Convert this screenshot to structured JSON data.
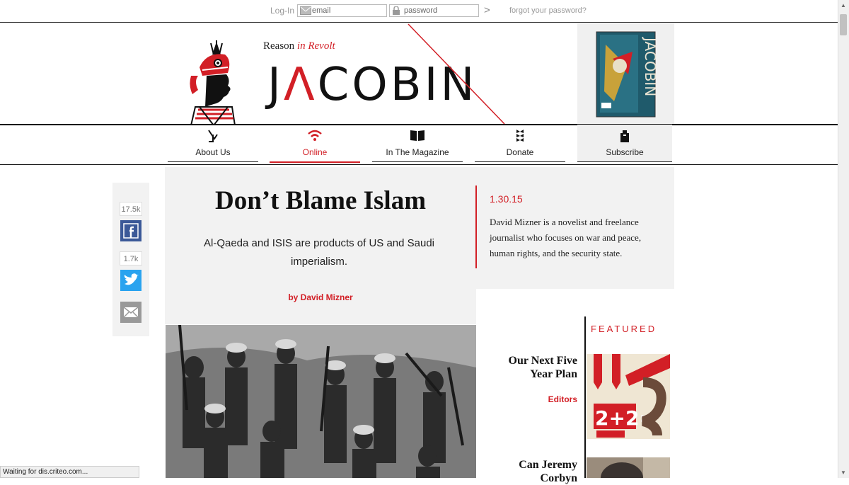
{
  "login": {
    "label": "Log-In",
    "email_placeholder": "email",
    "password_placeholder": "password",
    "submit_glyph": ">",
    "forgot_link": "forgot your password?"
  },
  "header": {
    "tagline_reason": "Reason",
    "tagline_revolt": "in Revolt",
    "wordmark_a": "J",
    "wordmark_b": "Λ",
    "wordmark_c": "COBIN"
  },
  "nav": {
    "items": [
      {
        "label": "About Us",
        "icon": "jacobin-j-icon"
      },
      {
        "label": "Online",
        "icon": "wifi-icon"
      },
      {
        "label": "In The Magazine",
        "icon": "book-icon"
      },
      {
        "label": "Donate",
        "icon": "wheat-icon"
      },
      {
        "label": "Subscribe",
        "icon": "mailbox-icon"
      }
    ],
    "active": "Online"
  },
  "share": {
    "facebook_count": "17.5k",
    "twitter_count": "1.7k"
  },
  "article": {
    "title": "Don’t Blame Islam",
    "subtitle": "Al-Qaeda and ISIS are products of US and Saudi imperialism.",
    "byline": "by David Mizner",
    "date": "1.30.15",
    "bio": "David Mizner is a novelist and freelance journalist who focuses on war and peace, human rights, and the security state."
  },
  "featured": {
    "heading": "FEATURED",
    "items": [
      {
        "title": "Our Next Five Year Plan",
        "author": "Editors"
      },
      {
        "title": "Can Jeremy Corbyn",
        "author": ""
      }
    ],
    "poster_text": "2+2="
  },
  "status": "Waiting for dis.criteo.com...",
  "colors": {
    "accent": "#d21f26",
    "panel": "#f2f2f2"
  }
}
